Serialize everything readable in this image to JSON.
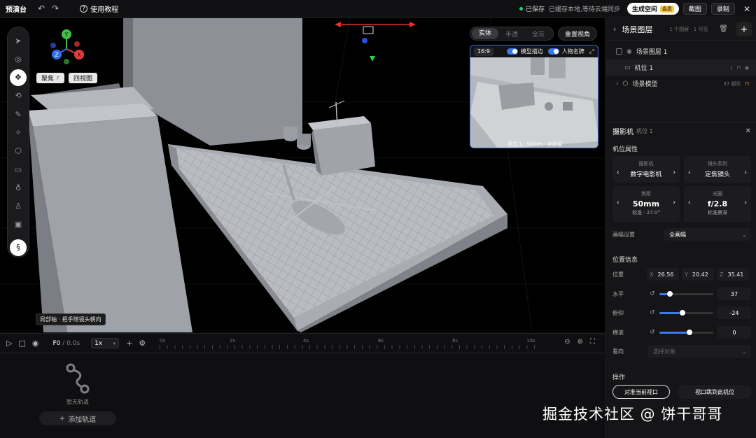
{
  "topbar": {
    "brand": "预演台",
    "help": "使用教程",
    "saved": "已保存",
    "sync": "已缓存本地,等待云端同步",
    "generate": "生成空间",
    "vip": "会员",
    "screenshot": "截图",
    "record": "录制"
  },
  "viewport": {
    "focus_btn": "聚焦",
    "focus_key": "F",
    "four_view_btn": "四视图",
    "modes": [
      "实体",
      "半透",
      "全灰"
    ],
    "reset_view": "重置视角",
    "hint": "局部轴 · 把手随镜头朝向",
    "gizmo": {
      "x": "X",
      "y": "Y",
      "z": "Z"
    }
  },
  "preview": {
    "ratio": "16:9",
    "outline_label": "模型描边",
    "nameplate_label": "人物名牌",
    "caption": "机位 1 · 50mm · 全画幅"
  },
  "timeline": {
    "frame": "F0",
    "time": "/ 0.0s",
    "speed": "1x",
    "ticks": [
      "0s",
      "2s",
      "4s",
      "6s",
      "8s",
      "10s"
    ],
    "empty_text": "暂无轨道",
    "add_track": "添加轨道"
  },
  "panel": {
    "title": "场景图层",
    "meta": "1 个图层 · 1 可见",
    "layers": [
      {
        "name": "场景图层 1"
      },
      {
        "name": "机位 1"
      },
      {
        "name": "场景模型",
        "count": "37 部件"
      }
    ],
    "camera": {
      "title": "摄影机",
      "sub": "机位 1",
      "props_title": "机位属性",
      "camera_label": "摄影机",
      "camera_value": "数字电影机",
      "lens_label": "镜头系列",
      "lens_value": "定焦镜头",
      "focal_label": "焦距",
      "focal_value": "50mm",
      "focal_note": "标准 · 27.0°",
      "aperture_label": "光圈",
      "aperture_value": "f/2.8",
      "aperture_note": "标准景深",
      "frame_label": "画幅设置",
      "frame_value": "全画幅"
    },
    "position": {
      "title": "位置信息",
      "pos_label": "位置",
      "x_label": "X",
      "x": "26.56",
      "y_label": "Y",
      "y": "20.42",
      "z_label": "Z",
      "z": "35.41",
      "pan_label": "水平",
      "pan": "37",
      "tilt_label": "俯仰",
      "tilt": "-24",
      "roll_label": "横滚",
      "roll": "0",
      "facing_label": "看向",
      "facing_placeholder": "选择对象"
    },
    "ops": {
      "title": "操作",
      "align_btn": "对准当前视口",
      "jump_btn": "视口跳到此机位"
    }
  },
  "watermark": "掘金技术社区 @ 饼干哥哥"
}
